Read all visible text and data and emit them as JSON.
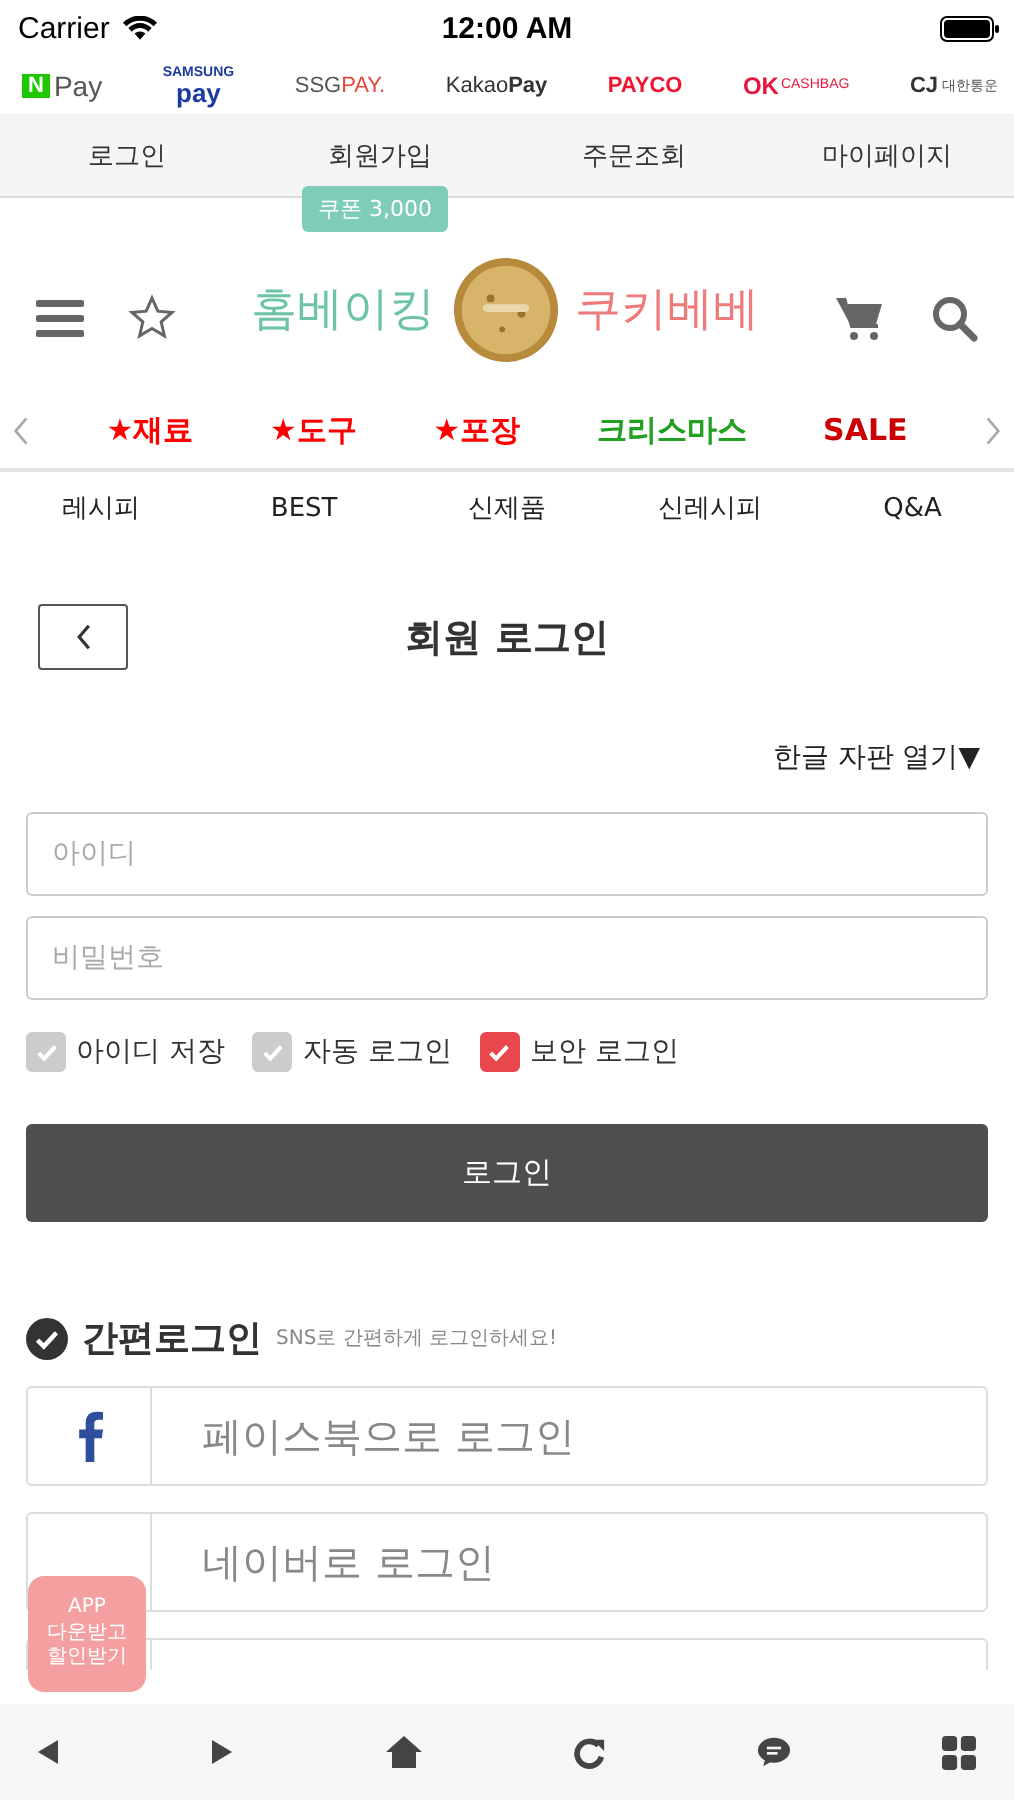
{
  "status_bar": {
    "carrier": "Carrier",
    "time": "12:00 AM"
  },
  "payment_logos": [
    {
      "parts": [
        "N",
        "Pay"
      ]
    },
    {
      "parts": [
        "SAMSUNG",
        "pay"
      ]
    },
    {
      "parts": [
        "SSG",
        "PAY."
      ]
    },
    {
      "parts": [
        "Kakao",
        "Pay"
      ]
    },
    {
      "parts": [
        "PAYCO"
      ]
    },
    {
      "parts": [
        "OK",
        "CASHBAG"
      ]
    },
    {
      "parts": [
        "CJ",
        "대한통운"
      ]
    }
  ],
  "top_nav": [
    "로그인",
    "회원가입",
    "주문조회",
    "마이페이지"
  ],
  "coupon_tooltip": "쿠폰 3,000",
  "brand": {
    "left": "홈베이킹",
    "right": "쿠키베베"
  },
  "categories": [
    {
      "label": "★재료",
      "color": "#ff0000"
    },
    {
      "label": "★도구",
      "color": "#ff0000"
    },
    {
      "label": "★포장",
      "color": "#ff0000"
    },
    {
      "label": "크리스마스",
      "color": "#22a022"
    },
    {
      "label": "SALE",
      "color": "#cc0000"
    }
  ],
  "sub_menu": [
    "레시피",
    "BEST",
    "신제품",
    "신레시피",
    "Q&A"
  ],
  "page_title": "회원 로그인",
  "keyboard_toggle": "한글 자판 열기▼",
  "fields": [
    {
      "placeholder": "아이디"
    },
    {
      "placeholder": "비밀번호"
    }
  ],
  "options": [
    {
      "label": "아이디 저장",
      "checked": false
    },
    {
      "label": "자동 로그인",
      "checked": false
    },
    {
      "label": "보안 로그인",
      "checked": true
    }
  ],
  "login_button": "로그인",
  "easy_login": {
    "title": "간편로그인",
    "subtitle": "SNS로 간편하게 로그인하세요!"
  },
  "sns_buttons": [
    {
      "kind": "facebook",
      "label": "페이스북으로 로그인"
    },
    {
      "kind": "naver",
      "label": "네이버로 로그인"
    },
    {
      "kind": "partial"
    }
  ],
  "app_badge": [
    "APP",
    "다운받고",
    "할인받기"
  ]
}
